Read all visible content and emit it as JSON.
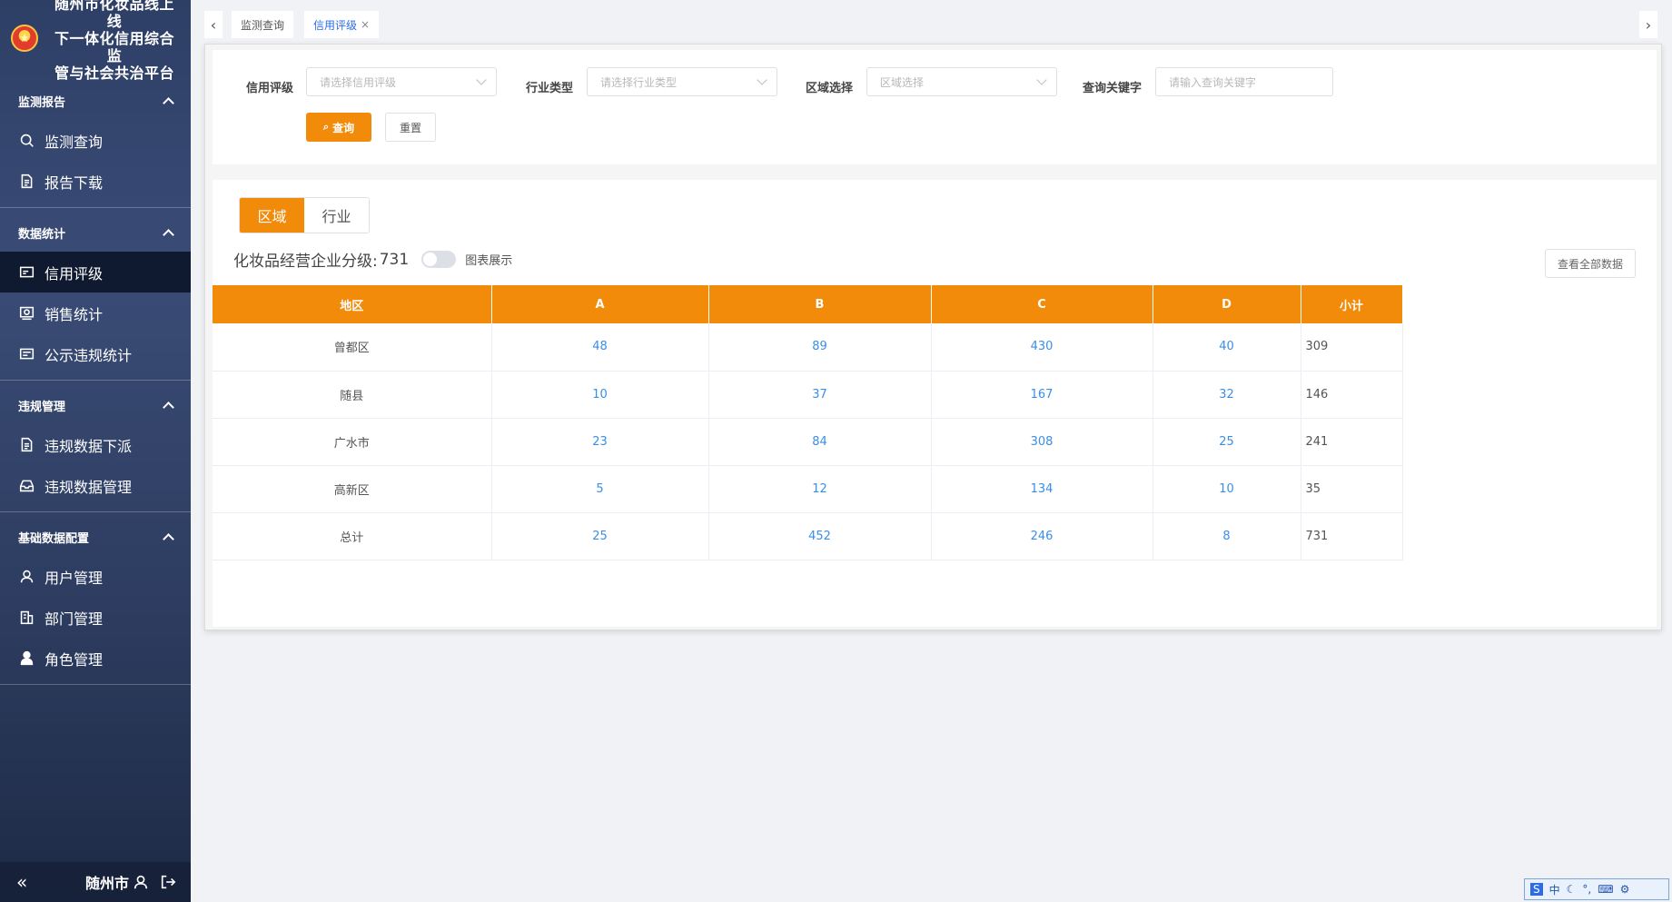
{
  "brand": {
    "title_lines": [
      "随州市化妆品线上线",
      "下一体化信用综合监",
      "管与社会共治平台"
    ]
  },
  "sidebar": {
    "groups": [
      {
        "title": "监测报告",
        "items": [
          {
            "label": "监测查询",
            "icon": "search-icon"
          },
          {
            "label": "报告下载",
            "icon": "document-icon"
          }
        ]
      },
      {
        "title": "数据统计",
        "items": [
          {
            "label": "信用评级",
            "icon": "card-icon",
            "active": true
          },
          {
            "label": "销售统计",
            "icon": "chart-card-icon"
          },
          {
            "label": "公示违规统计",
            "icon": "list-card-icon"
          }
        ]
      },
      {
        "title": "违规管理",
        "items": [
          {
            "label": "违规数据下派",
            "icon": "document-icon"
          },
          {
            "label": "违规数据管理",
            "icon": "inbox-icon"
          }
        ]
      },
      {
        "title": "基础数据配置",
        "items": [
          {
            "label": "用户管理",
            "icon": "user-icon"
          },
          {
            "label": "部门管理",
            "icon": "building-icon"
          },
          {
            "label": "角色管理",
            "icon": "person-solid-icon"
          }
        ]
      }
    ],
    "footer": {
      "city": "随州市"
    }
  },
  "tabs": [
    {
      "label": "监测查询"
    },
    {
      "label": "信用评级",
      "active": true
    }
  ],
  "filter": {
    "credit_label": "信用评级",
    "credit_placeholder": "请选择信用评级",
    "industry_label": "行业类型",
    "industry_placeholder": "请选择行业类型",
    "region_label": "区域选择",
    "region_placeholder": "区域选择",
    "keyword_label": "查询关键字",
    "keyword_placeholder": "请输入查询关键字",
    "query_label": "查询",
    "reset_label": "重置"
  },
  "main": {
    "segments": [
      "区域",
      "行业"
    ],
    "summary_label": "化妆品经营企业分级:",
    "summary_count": "731",
    "toggle_label": "图表展示",
    "view_all_label": "查看全部数据"
  },
  "table": {
    "headers": [
      "地区",
      "A",
      "B",
      "C",
      "D",
      "小计"
    ],
    "rows": [
      [
        "曾都区",
        "48",
        "89",
        "430",
        "40",
        "309"
      ],
      [
        "随县",
        "10",
        "37",
        "167",
        "32",
        "146"
      ],
      [
        "广水市",
        "23",
        "84",
        "308",
        "25",
        "241"
      ],
      [
        "高新区",
        "5",
        "12",
        "134",
        "10",
        "35"
      ],
      [
        "总计",
        "25",
        "452",
        "246",
        "8",
        "731"
      ]
    ]
  },
  "ime": {
    "label": "中"
  }
}
